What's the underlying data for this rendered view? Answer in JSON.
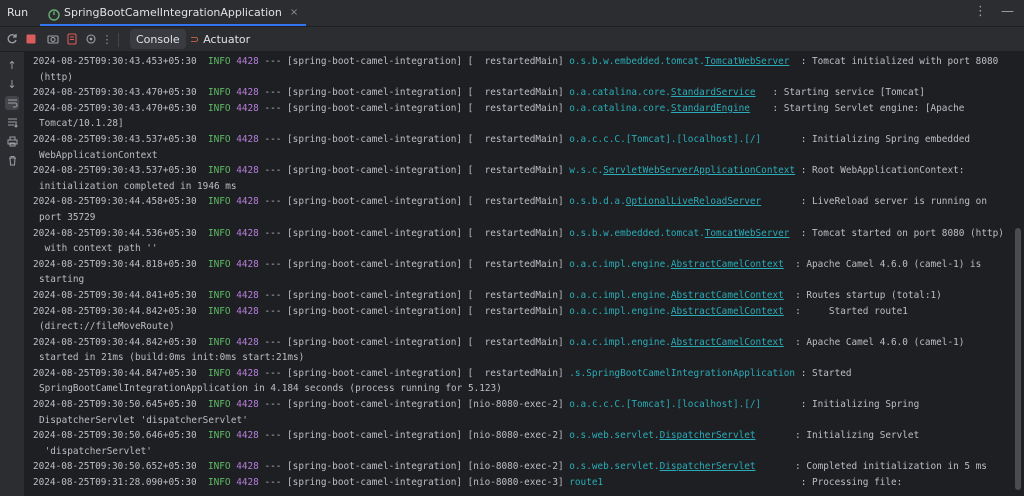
{
  "topbar": {
    "run_label": "Run",
    "tab_label": "SpringBootCamelIntegrationApplication",
    "tab_close": "×",
    "more_icon": "⋮",
    "minimize_icon": "—"
  },
  "toolbar": {
    "console_label": "Console",
    "actuator_label": "Actuator"
  },
  "log": [
    {
      "ts": "2024-08-25T09:30:43.453+05:30",
      "level": "INFO",
      "pid": "4428",
      "sep": "---",
      "app": "[spring-boot-camel-integration]",
      "thread": "[  restartedMain]",
      "logger_prefix": "o.s.b.w.embedded.tomcat.",
      "logger_link": "TomcatWebServer",
      "logger_pad": "  ",
      "msg": ": Tomcat initialized with port 8080",
      "cont": "(http)"
    },
    {
      "ts": "2024-08-25T09:30:43.470+05:30",
      "level": "INFO",
      "pid": "4428",
      "sep": "---",
      "app": "[spring-boot-camel-integration]",
      "thread": "[  restartedMain]",
      "logger_prefix": "o.a.catalina.core.",
      "logger_link": "StandardService",
      "logger_pad": "   ",
      "msg": ": Starting service [Tomcat]",
      "cont": ""
    },
    {
      "ts": "2024-08-25T09:30:43.470+05:30",
      "level": "INFO",
      "pid": "4428",
      "sep": "---",
      "app": "[spring-boot-camel-integration]",
      "thread": "[  restartedMain]",
      "logger_prefix": "o.a.catalina.core.",
      "logger_link": "StandardEngine",
      "logger_pad": "    ",
      "msg": ": Starting Servlet engine: [Apache",
      "cont": "Tomcat/10.1.28]"
    },
    {
      "ts": "2024-08-25T09:30:43.537+05:30",
      "level": "INFO",
      "pid": "4428",
      "sep": "---",
      "app": "[spring-boot-camel-integration]",
      "thread": "[  restartedMain]",
      "logger_prefix": "o.a.c.c.C.[Tomcat].[localhost].[/]",
      "logger_link": "",
      "logger_pad": "       ",
      "msg": ": Initializing Spring embedded",
      "cont": "WebApplicationContext"
    },
    {
      "ts": "2024-08-25T09:30:43.537+05:30",
      "level": "INFO",
      "pid": "4428",
      "sep": "---",
      "app": "[spring-boot-camel-integration]",
      "thread": "[  restartedMain]",
      "logger_prefix": "w.s.c.",
      "logger_link": "ServletWebServerApplicationContext",
      "logger_pad": " ",
      "msg": ": Root WebApplicationContext:",
      "cont": "initialization completed in 1946 ms"
    },
    {
      "ts": "2024-08-25T09:30:44.458+05:30",
      "level": "INFO",
      "pid": "4428",
      "sep": "---",
      "app": "[spring-boot-camel-integration]",
      "thread": "[  restartedMain]",
      "logger_prefix": "o.s.b.d.a.",
      "logger_link": "OptionalLiveReloadServer",
      "logger_pad": "       ",
      "msg": ": LiveReload server is running on",
      "cont": "port 35729"
    },
    {
      "ts": "2024-08-25T09:30:44.536+05:30",
      "level": "INFO",
      "pid": "4428",
      "sep": "---",
      "app": "[spring-boot-camel-integration]",
      "thread": "[  restartedMain]",
      "logger_prefix": "o.s.b.w.embedded.tomcat.",
      "logger_link": "TomcatWebServer",
      "logger_pad": "  ",
      "msg": ": Tomcat started on port 8080 (http)",
      "cont": " with context path ''"
    },
    {
      "ts": "2024-08-25T09:30:44.818+05:30",
      "level": "INFO",
      "pid": "4428",
      "sep": "---",
      "app": "[spring-boot-camel-integration]",
      "thread": "[  restartedMain]",
      "logger_prefix": "o.a.c.impl.engine.",
      "logger_link": "AbstractCamelContext",
      "logger_pad": "  ",
      "msg": ": Apache Camel 4.6.0 (camel-1) is",
      "cont": "starting"
    },
    {
      "ts": "2024-08-25T09:30:44.841+05:30",
      "level": "INFO",
      "pid": "4428",
      "sep": "---",
      "app": "[spring-boot-camel-integration]",
      "thread": "[  restartedMain]",
      "logger_prefix": "o.a.c.impl.engine.",
      "logger_link": "AbstractCamelContext",
      "logger_pad": "  ",
      "msg": ": Routes startup (total:1)",
      "cont": ""
    },
    {
      "ts": "2024-08-25T09:30:44.842+05:30",
      "level": "INFO",
      "pid": "4428",
      "sep": "---",
      "app": "[spring-boot-camel-integration]",
      "thread": "[  restartedMain]",
      "logger_prefix": "o.a.c.impl.engine.",
      "logger_link": "AbstractCamelContext",
      "logger_pad": "  ",
      "msg": ":     Started route1",
      "cont": "(direct://fileMoveRoute)"
    },
    {
      "ts": "2024-08-25T09:30:44.842+05:30",
      "level": "INFO",
      "pid": "4428",
      "sep": "---",
      "app": "[spring-boot-camel-integration]",
      "thread": "[  restartedMain]",
      "logger_prefix": "o.a.c.impl.engine.",
      "logger_link": "AbstractCamelContext",
      "logger_pad": "  ",
      "msg": ": Apache Camel 4.6.0 (camel-1)",
      "cont": "started in 21ms (build:0ms init:0ms start:21ms)"
    },
    {
      "ts": "2024-08-25T09:30:44.847+05:30",
      "level": "INFO",
      "pid": "4428",
      "sep": "---",
      "app": "[spring-boot-camel-integration]",
      "thread": "[  restartedMain]",
      "logger_prefix": ".s.SpringBootCamelIntegrationApplication",
      "logger_link": "",
      "logger_pad": " ",
      "msg": ": Started",
      "cont": "SpringBootCamelIntegrationApplication in 4.184 seconds (process running for 5.123)"
    },
    {
      "ts": "2024-08-25T09:30:50.645+05:30",
      "level": "INFO",
      "pid": "4428",
      "sep": "---",
      "app": "[spring-boot-camel-integration]",
      "thread": "[nio-8080-exec-2]",
      "logger_prefix": "o.a.c.c.C.[Tomcat].[localhost].[/]",
      "logger_link": "",
      "logger_pad": "       ",
      "msg": ": Initializing Spring",
      "cont": "DispatcherServlet 'dispatcherServlet'"
    },
    {
      "ts": "2024-08-25T09:30:50.646+05:30",
      "level": "INFO",
      "pid": "4428",
      "sep": "---",
      "app": "[spring-boot-camel-integration]",
      "thread": "[nio-8080-exec-2]",
      "logger_prefix": "o.s.web.servlet.",
      "logger_link": "DispatcherServlet",
      "logger_pad": "       ",
      "msg": ": Initializing Servlet",
      "cont": " 'dispatcherServlet'"
    },
    {
      "ts": "2024-08-25T09:30:50.652+05:30",
      "level": "INFO",
      "pid": "4428",
      "sep": "---",
      "app": "[spring-boot-camel-integration]",
      "thread": "[nio-8080-exec-2]",
      "logger_prefix": "o.s.web.servlet.",
      "logger_link": "DispatcherServlet",
      "logger_pad": "       ",
      "msg": ": Completed initialization in 5 ms",
      "cont": ""
    },
    {
      "ts": "2024-08-25T09:31:28.090+05:30",
      "level": "INFO",
      "pid": "4428",
      "sep": "---",
      "app": "[spring-boot-camel-integration]",
      "thread": "[nio-8080-exec-3]",
      "logger_prefix": "route1",
      "logger_link": "",
      "logger_pad": "                                   ",
      "msg": ": Processing file:",
      "cont": ""
    }
  ]
}
